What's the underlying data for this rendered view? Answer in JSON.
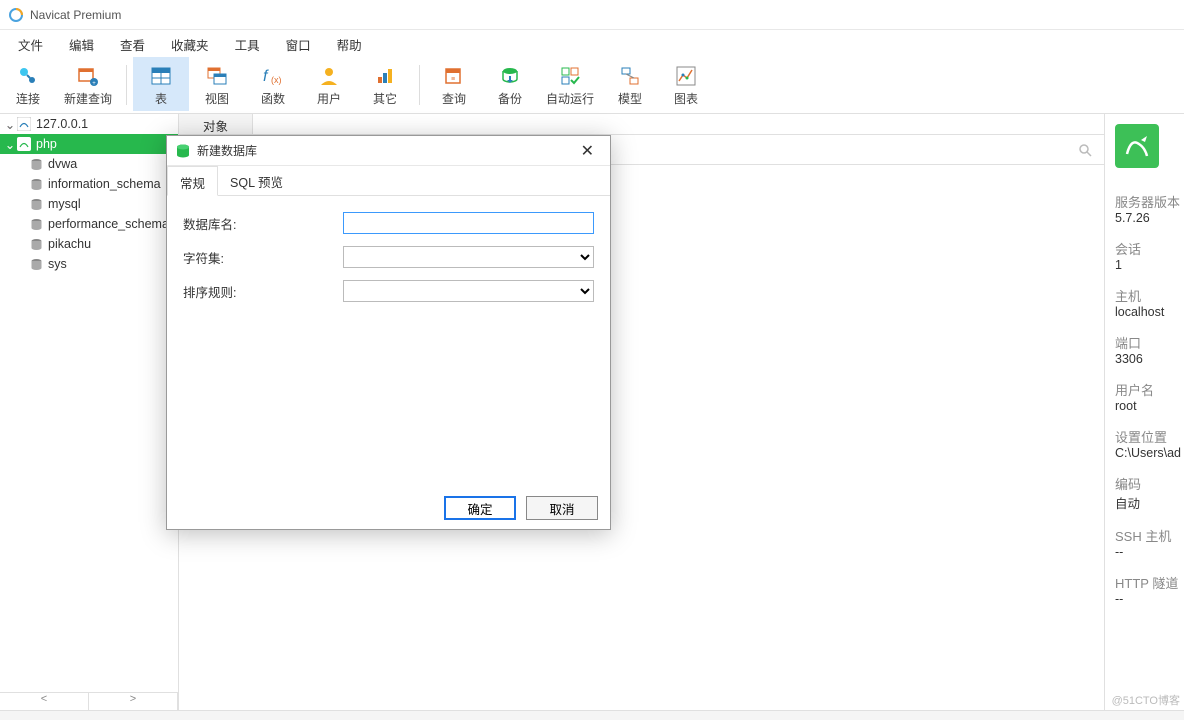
{
  "title": "Navicat Premium",
  "menus": [
    "文件",
    "编辑",
    "查看",
    "收藏夹",
    "工具",
    "窗口",
    "帮助"
  ],
  "toolbar": [
    {
      "id": "connect",
      "label": "连接"
    },
    {
      "id": "newquery",
      "label": "新建查询"
    },
    {
      "id": "table",
      "label": "表",
      "active": true
    },
    {
      "id": "view",
      "label": "视图"
    },
    {
      "id": "function",
      "label": "函数"
    },
    {
      "id": "user",
      "label": "用户"
    },
    {
      "id": "other",
      "label": "其它"
    },
    {
      "id": "query",
      "label": "查询"
    },
    {
      "id": "backup",
      "label": "备份"
    },
    {
      "id": "auto",
      "label": "自动运行"
    },
    {
      "id": "model",
      "label": "模型"
    },
    {
      "id": "chart",
      "label": "图表"
    }
  ],
  "tree": {
    "server": "127.0.0.1",
    "conn": "php",
    "dbs": [
      "dvwa",
      "information_schema",
      "mysql",
      "performance_schema",
      "pikachu",
      "sys"
    ]
  },
  "main_tabs": {
    "objects": "对象"
  },
  "dialog": {
    "title": "新建数据库",
    "tabs": {
      "general": "常规",
      "sql": "SQL 预览"
    },
    "fields": {
      "name": "数据库名:",
      "charset": "字符集:",
      "collation": "排序规则:"
    },
    "buttons": {
      "ok": "确定",
      "cancel": "取消"
    }
  },
  "info": [
    {
      "k": "服务器版本",
      "v": "5.7.26"
    },
    {
      "k": "会话",
      "v": "1"
    },
    {
      "k": "主机",
      "v": "localhost"
    },
    {
      "k": "端口",
      "v": "3306"
    },
    {
      "k": "用户名",
      "v": "root"
    },
    {
      "k": "设置位置",
      "v": "C:\\Users\\ad"
    },
    {
      "k": "编码",
      "v": "自动"
    },
    {
      "k": "SSH 主机",
      "v": "--"
    },
    {
      "k": "HTTP 隧道",
      "v": "--"
    }
  ],
  "watermark": "@51CTO博客"
}
